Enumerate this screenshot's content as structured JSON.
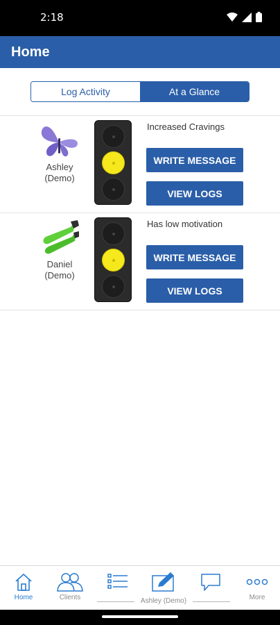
{
  "status_bar": {
    "time": "2:18"
  },
  "app_bar": {
    "title": "Home"
  },
  "segmented": {
    "options": [
      "Log Activity",
      "At a Glance"
    ],
    "selected": "At a Glance"
  },
  "clients": [
    {
      "name": "Ashley\n(Demo)",
      "avatar": "butterfly-icon",
      "light_level": "yellow",
      "status": "Increased Cravings",
      "write_label": "WRITE MESSAGE",
      "view_label": "VIEW LOGS"
    },
    {
      "name": "Daniel\n(Demo)",
      "avatar": "swim-fins-icon",
      "light_level": "yellow",
      "status": "Has low motivation",
      "write_label": "WRITE MESSAGE",
      "view_label": "VIEW LOGS"
    }
  ],
  "bottom_nav": {
    "home": "Home",
    "clients": "Clients",
    "group_label": "Ashley (Demo)",
    "more": "More",
    "active": "Home"
  },
  "colors": {
    "primary": "#2a5ea8",
    "traffic_yellow": "#f5e81c",
    "nav_active": "#2a7bd0"
  }
}
